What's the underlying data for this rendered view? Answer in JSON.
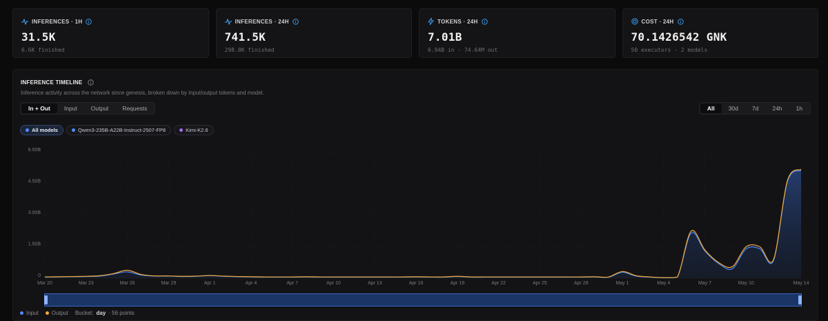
{
  "stats": [
    {
      "label": "INFERENCES · 1H",
      "value": "31.5K",
      "sub": "6.6K finished",
      "icon": "pulse-icon"
    },
    {
      "label": "INFERENCES · 24H",
      "value": "741.5K",
      "sub": "298.8K finished",
      "icon": "pulse-icon"
    },
    {
      "label": "TOKENS · 24H",
      "value": "7.01B",
      "sub": "6.94B in · 74.64M out",
      "icon": "lightning-icon"
    },
    {
      "label": "COST · 24H",
      "value": "70.1426542 GNK",
      "sub": "50 executors · 2 models",
      "icon": "coin-icon"
    }
  ],
  "panel": {
    "title": "INFERENCE TIMELINE",
    "description": "Inference activity across the network since genesis, broken down by input/output tokens and model."
  },
  "metric_tabs": [
    "In + Out",
    "Input",
    "Output",
    "Requests"
  ],
  "range_tabs": [
    "All",
    "30d",
    "7d",
    "24h",
    "1h"
  ],
  "models": [
    {
      "label": "All models",
      "color": "#4f8ff7"
    },
    {
      "label": "Qwen3-235B-A22B-Instruct-2507-FP8",
      "color": "#4f8ff7"
    },
    {
      "label": "Kimi-K2.6",
      "color": "#a26bf2"
    }
  ],
  "legend": {
    "input": "Input",
    "output": "Output",
    "bucket_label": "Bucket:",
    "bucket_value": "day",
    "points": "· 56 points"
  },
  "colors": {
    "input": "#4f8ff7",
    "output": "#f2a93b",
    "accent": "#3ea6ff"
  },
  "chart_data": {
    "type": "area",
    "y_ticks": [
      "0",
      "1.50B",
      "3.00B",
      "4.50B",
      "6.00B"
    ],
    "ylim": [
      0,
      6.0
    ],
    "x_ticks": [
      "Mar 20",
      "Mar 23",
      "Mar 26",
      "Mar 29",
      "Apr 1",
      "Apr 4",
      "Apr 7",
      "Apr 10",
      "Apr 13",
      "Apr 16",
      "Apr 19",
      "Apr 22",
      "Apr 25",
      "Apr 28",
      "May 1",
      "May 4",
      "May 7",
      "May 10",
      "May 14"
    ],
    "x": [
      "Mar 20",
      "Mar 21",
      "Mar 22",
      "Mar 23",
      "Mar 24",
      "Mar 25",
      "Mar 26",
      "Mar 27",
      "Mar 28",
      "Mar 29",
      "Mar 30",
      "Mar 31",
      "Apr 1",
      "Apr 2",
      "Apr 3",
      "Apr 4",
      "Apr 5",
      "Apr 6",
      "Apr 7",
      "Apr 8",
      "Apr 9",
      "Apr 10",
      "Apr 11",
      "Apr 12",
      "Apr 13",
      "Apr 14",
      "Apr 15",
      "Apr 16",
      "Apr 17",
      "Apr 18",
      "Apr 19",
      "Apr 20",
      "Apr 21",
      "Apr 22",
      "Apr 23",
      "Apr 24",
      "Apr 25",
      "Apr 26",
      "Apr 27",
      "Apr 28",
      "Apr 29",
      "Apr 30",
      "May 1",
      "May 2",
      "May 3",
      "May 4",
      "May 5",
      "May 6",
      "May 7",
      "May 8",
      "May 9",
      "May 10",
      "May 11",
      "May 12",
      "May 13",
      "May 14"
    ],
    "series": [
      {
        "name": "Input",
        "values": [
          0.05,
          0.06,
          0.07,
          0.08,
          0.1,
          0.2,
          0.3,
          0.15,
          0.1,
          0.1,
          0.08,
          0.09,
          0.12,
          0.09,
          0.07,
          0.06,
          0.05,
          0.05,
          0.05,
          0.06,
          0.05,
          0.05,
          0.05,
          0.05,
          0.05,
          0.05,
          0.05,
          0.06,
          0.05,
          0.05,
          0.08,
          0.05,
          0.05,
          0.05,
          0.05,
          0.05,
          0.05,
          0.05,
          0.05,
          0.05,
          0.06,
          0.05,
          0.28,
          0.1,
          0.05,
          0.02,
          0.05,
          2.15,
          1.3,
          0.7,
          0.45,
          1.4,
          1.4,
          0.85,
          4.6,
          5.15
        ]
      },
      {
        "name": "Output",
        "values": [
          0.06,
          0.07,
          0.08,
          0.09,
          0.12,
          0.22,
          0.38,
          0.18,
          0.11,
          0.11,
          0.09,
          0.1,
          0.13,
          0.1,
          0.08,
          0.07,
          0.06,
          0.06,
          0.06,
          0.07,
          0.06,
          0.06,
          0.06,
          0.06,
          0.06,
          0.06,
          0.06,
          0.07,
          0.06,
          0.06,
          0.09,
          0.06,
          0.06,
          0.06,
          0.06,
          0.06,
          0.06,
          0.06,
          0.06,
          0.06,
          0.07,
          0.06,
          0.32,
          0.12,
          0.06,
          0.03,
          0.06,
          2.25,
          1.35,
          0.75,
          0.55,
          1.5,
          1.5,
          0.9,
          4.65,
          5.2
        ]
      }
    ]
  }
}
